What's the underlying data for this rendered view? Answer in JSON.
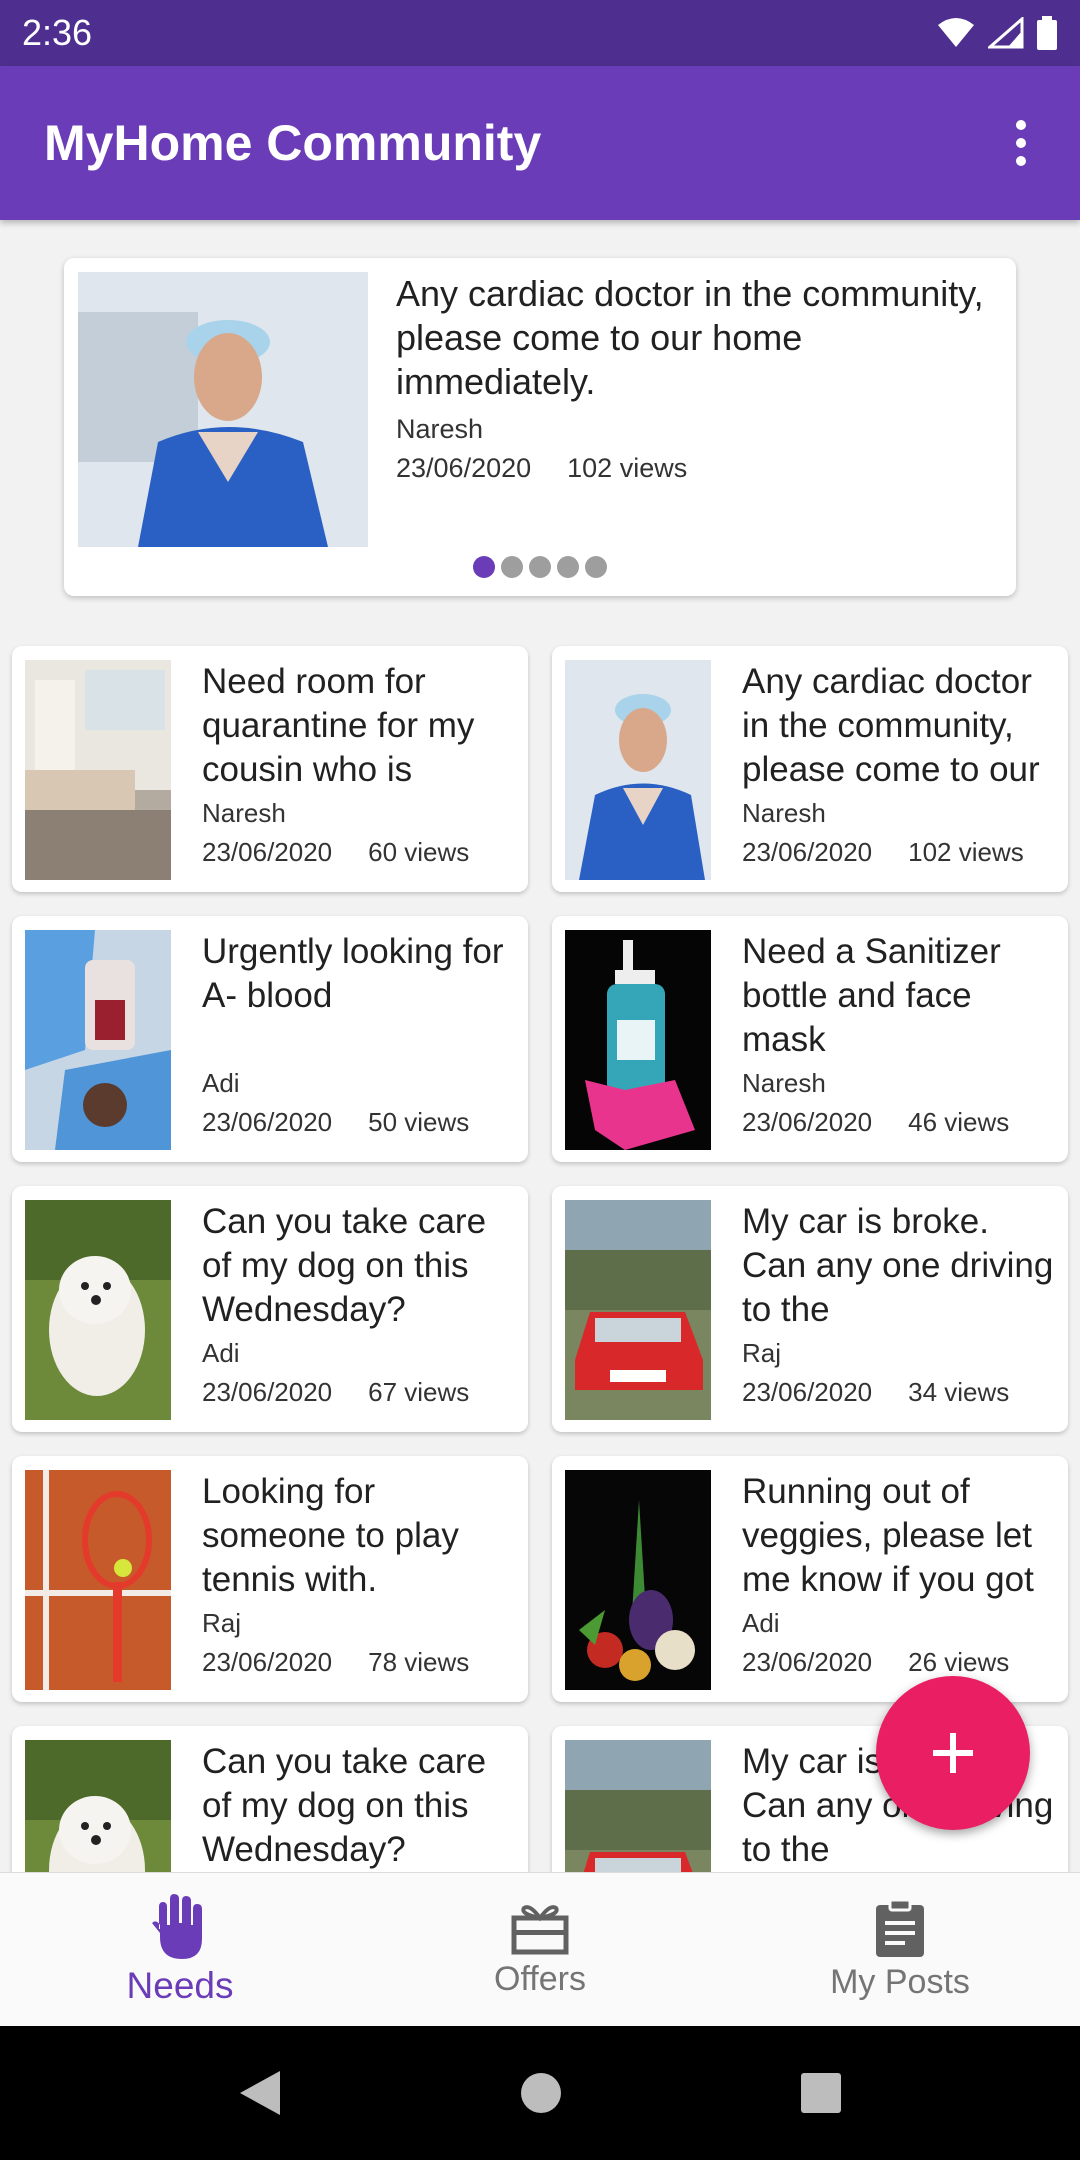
{
  "status_bar": {
    "time": "2:36"
  },
  "app_bar": {
    "title": "MyHome Community"
  },
  "featured": {
    "title": "Any cardiac doctor in the community, please come to our home immediately.",
    "author": "Naresh",
    "date": "23/06/2020",
    "views": "102 views",
    "image": "doctor-photo",
    "pager_total": 5,
    "pager_active": 1
  },
  "posts": [
    {
      "title": "Need room for quarantine for my cousin who is",
      "author": "Naresh",
      "date": "23/06/2020",
      "views": "60 views",
      "image": "bedroom-photo"
    },
    {
      "title": "Any cardiac doctor in the community, please come to our",
      "author": "Naresh",
      "date": "23/06/2020",
      "views": "102 views",
      "image": "doctor-photo"
    },
    {
      "title": "Urgently looking for A- blood",
      "author": "Adi",
      "date": "23/06/2020",
      "views": "50 views",
      "image": "blood-bag-photo"
    },
    {
      "title": "Need a Sanitizer bottle and face mask",
      "author": "Naresh",
      "date": "23/06/2020",
      "views": "46 views",
      "image": "sanitizer-photo"
    },
    {
      "title": "Can you take care of my dog on this Wednesday?",
      "author": "Adi",
      "date": "23/06/2020",
      "views": "67 views",
      "image": "dog-photo"
    },
    {
      "title": "My car is broke. Can any one driving to the",
      "author": "Raj",
      "date": "23/06/2020",
      "views": "34 views",
      "image": "red-car-photo"
    },
    {
      "title": "Looking for someone to play tennis with.",
      "author": "Raj",
      "date": "23/06/2020",
      "views": "78 views",
      "image": "tennis-photo"
    },
    {
      "title": "Running out of veggies, please let me know if you got",
      "author": "Adi",
      "date": "23/06/2020",
      "views": "26 views",
      "image": "vegetables-photo"
    },
    {
      "title": "Can you take care of my dog on this Wednesday?",
      "author": "",
      "date": "",
      "views": "",
      "image": "dog-photo"
    },
    {
      "title": "My car is broke. Can any one driving to the",
      "author": "",
      "date": "",
      "views": "",
      "image": "red-car-photo"
    }
  ],
  "bottom_nav": [
    {
      "label": "Needs",
      "icon": "hand-icon",
      "active": true
    },
    {
      "label": "Offers",
      "icon": "gift-icon",
      "active": false
    },
    {
      "label": "My Posts",
      "icon": "clipboard-icon",
      "active": false
    }
  ],
  "colors": {
    "primary": "#6b3cb8",
    "primary_dark": "#4e2f8f",
    "accent": "#e91e63"
  }
}
